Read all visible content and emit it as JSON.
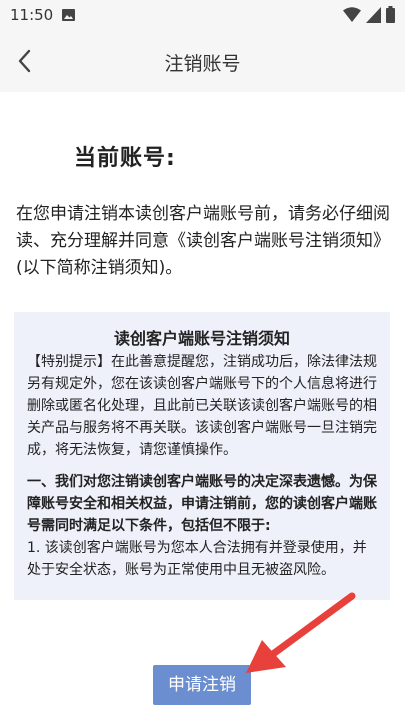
{
  "status_bar": {
    "time": "11:50",
    "icons": [
      "photo-icon",
      "wifi-icon",
      "signal-icon",
      "battery-icon"
    ]
  },
  "header": {
    "title": "注销账号",
    "back_icon": "chevron-left-icon"
  },
  "main": {
    "account_title": "当前账号:",
    "intro": "在您申请注销本读创客户端账号前，请务必仔细阅读、充分理解并同意《读创客户端账号注销须知》(以下简称注销须知)。"
  },
  "notice": {
    "heading": "读创客户端账号注销须知",
    "paragraph1": "【特别提示】在此善意提醒您，注销成功后，除法律法规另有规定外，您在该读创客户端账号下的个人信息将进行删除或匿名化处理，且此前已关联该读创客户端账号的相关产品与服务将不再关联。该读创客户端账号一旦注销完成，将无法恢复，请您谨慎操作。",
    "section1": "一、我们对您注销读创客户端账号的决定深表遗憾。为保障账号安全和相关权益，申请注销前，您的读创客户端账号需同时满足以下条件，包括但不限于:",
    "item1": "1. 该读创客户端账号为您本人合法拥有并登录使用，并处于安全状态，账号为正常使用中且无被盗风险。"
  },
  "actions": {
    "apply_label": "申请注销"
  },
  "colors": {
    "button_bg": "#6b8ed1",
    "notice_bg": "#eef1fa",
    "annotation_arrow": "#e8403a"
  }
}
